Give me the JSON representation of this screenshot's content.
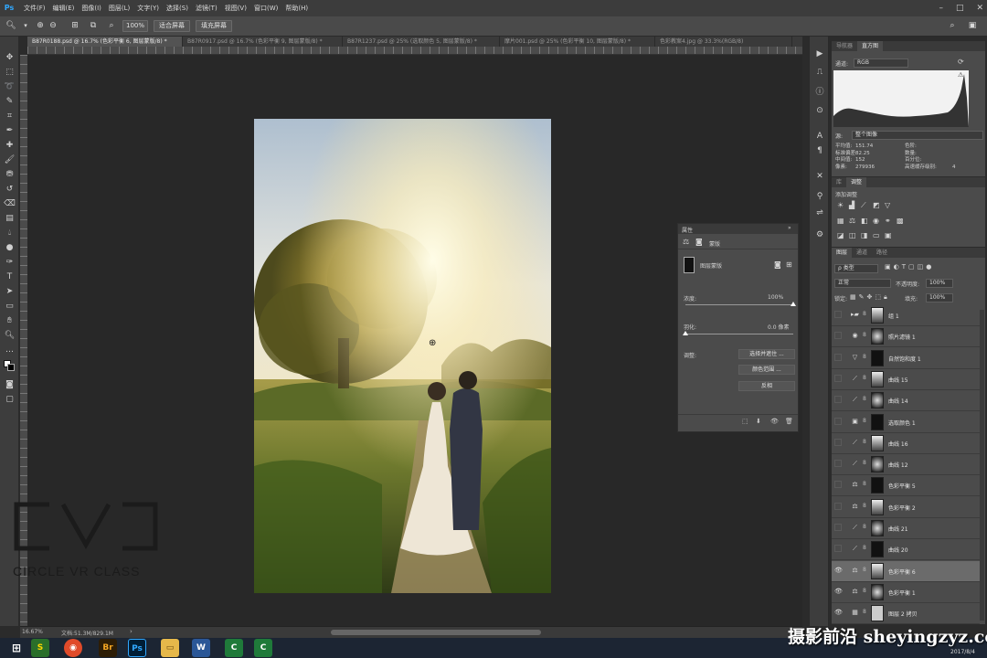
{
  "app": {
    "logo": "Ps"
  },
  "menu": [
    "文件(F)",
    "编辑(E)",
    "图像(I)",
    "图层(L)",
    "文字(Y)",
    "选择(S)",
    "滤镜(T)",
    "视图(V)",
    "窗口(W)",
    "帮助(H)"
  ],
  "options": {
    "zoom_value": "100%",
    "fit_screen": "适合屏幕",
    "fill_screen": "填充屏幕"
  },
  "tabs": [
    {
      "label": "B87R0188.psd @ 16.7% (色彩平衡 6, 图层蒙版/8) *",
      "active": true
    },
    {
      "label": "B87R0917.psd @ 16.7% (色彩平衡 9, 图层蒙版/8) *",
      "active": false
    },
    {
      "label": "B87R1237.psd @ 25% (选取颜色 5, 图层蒙版/8) *",
      "active": false
    },
    {
      "label": "摩片001.psd @ 25% (色彩平衡 10, 图层蒙版/8) *",
      "active": false
    },
    {
      "label": "色彩教案4.jpg @ 33.3%(RGB/8)",
      "active": false
    }
  ],
  "status": {
    "zoom": "16.67%",
    "doc": "文档:51.3M/829.1M"
  },
  "histogram": {
    "tabs": [
      "导航器",
      "直方图"
    ],
    "channel_label": "通道:",
    "channel_value": "RGB",
    "source_label": "源:",
    "source_value": "整个图像",
    "stats": {
      "mean_label": "平均值:",
      "mean": "151.74",
      "std_label": "标准偏差:",
      "std": "82.25",
      "median_label": "中间值:",
      "median": "152",
      "pixels_label": "像素:",
      "pixels": "279936",
      "level_label": "色阶:",
      "count_label": "数量:",
      "percent_label": "百分位:",
      "cache_label": "高速缓存级别:",
      "cache": "4"
    }
  },
  "adjustments": {
    "tabs": [
      "库",
      "调整"
    ],
    "add_label": "添加调整"
  },
  "layers_panel": {
    "tabs": [
      "图层",
      "通道",
      "路径"
    ],
    "filter_label": "ρ 类型",
    "blend_mode": "正常",
    "opacity_label": "不透明度:",
    "opacity": "100%",
    "lock_label": "锁定:",
    "fill_label": "填充:",
    "fill": "100%",
    "layers": [
      {
        "name": "组 1",
        "icon": "folder",
        "visible": false,
        "selected": false
      },
      {
        "name": "照片滤镜 1",
        "icon": "filter",
        "visible": false,
        "selected": false
      },
      {
        "name": "自然饱和度 1",
        "icon": "vibrance",
        "visible": false,
        "selected": false
      },
      {
        "name": "曲线 15",
        "icon": "curves",
        "visible": false,
        "selected": false
      },
      {
        "name": "曲线 14",
        "icon": "curves",
        "visible": false,
        "selected": false
      },
      {
        "name": "选取颜色 1",
        "icon": "selective",
        "visible": false,
        "selected": false
      },
      {
        "name": "曲线 16",
        "icon": "curves",
        "visible": false,
        "selected": false
      },
      {
        "name": "曲线 12",
        "icon": "curves",
        "visible": false,
        "selected": false
      },
      {
        "name": "色彩平衡 5",
        "icon": "balance",
        "visible": false,
        "selected": false
      },
      {
        "name": "色彩平衡 2",
        "icon": "balance",
        "visible": false,
        "selected": false
      },
      {
        "name": "曲线 21",
        "icon": "curves",
        "visible": false,
        "selected": false
      },
      {
        "name": "曲线 20",
        "icon": "curves",
        "visible": false,
        "selected": false
      },
      {
        "name": "色彩平衡 6",
        "icon": "balance",
        "visible": true,
        "selected": true
      },
      {
        "name": "色彩平衡 1",
        "icon": "balance",
        "visible": true,
        "selected": false
      },
      {
        "name": "图层 2 拷贝",
        "icon": "pixel",
        "visible": true,
        "selected": false
      }
    ]
  },
  "properties": {
    "title": "属性",
    "mask_label": "蒙版",
    "layer_mask_label": "图层蒙版",
    "density_label": "浓度:",
    "density_value": "100%",
    "density_fraction": 1.0,
    "feather_label": "羽化:",
    "feather_value": "0.0 像素",
    "feather_fraction": 0.0,
    "refine_label": "调整:",
    "btn_select_mask": "选择并遮住 ...",
    "btn_color_range": "颜色范围 ...",
    "btn_invert": "反相"
  },
  "watermark": {
    "logo_text": "CVC",
    "tagline": "CIRCLE VR CLASS",
    "site": "摄影前沿 sheyingzyz.com"
  },
  "taskbar": {
    "date": "2017/8/4"
  }
}
